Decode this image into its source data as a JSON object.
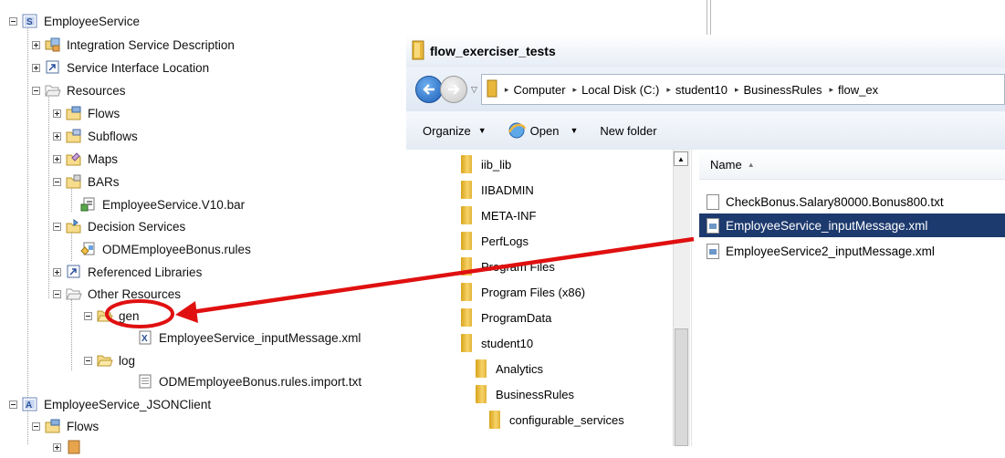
{
  "tree": {
    "items": [
      {
        "label": "EmployeeService"
      },
      {
        "label": "Integration Service Description"
      },
      {
        "label": "Service Interface Location"
      },
      {
        "label": "Resources"
      },
      {
        "label": "Flows"
      },
      {
        "label": "Subflows"
      },
      {
        "label": "Maps"
      },
      {
        "label": "BARs"
      },
      {
        "label": "EmployeeService.V10.bar"
      },
      {
        "label": "Decision Services"
      },
      {
        "label": "ODMEmployeeBonus.rules"
      },
      {
        "label": "Referenced Libraries"
      },
      {
        "label": "Other Resources"
      },
      {
        "label": "gen"
      },
      {
        "label": "EmployeeService_inputMessage.xml"
      },
      {
        "label": "log"
      },
      {
        "label": "ODMEmployeeBonus.rules.import.txt"
      },
      {
        "label": "EmployeeService_JSONClient"
      },
      {
        "label": "Flows"
      }
    ]
  },
  "explorer": {
    "title": "flow_exerciser_tests",
    "breadcrumbs": [
      "Computer",
      "Local Disk (C:)",
      "student10",
      "BusinessRules",
      "flow_ex"
    ],
    "toolbar": {
      "organize": "Organize",
      "open": "Open",
      "new_folder": "New folder"
    },
    "nav_folders": [
      "iib_lib",
      "IIBADMIN",
      "META-INF",
      "PerfLogs",
      "Program Files",
      "Program Files (x86)",
      "ProgramData",
      "student10",
      "Analytics",
      "BusinessRules",
      "configurable_services"
    ],
    "column_header": "Name",
    "files": [
      {
        "name": "CheckBonus.Salary80000.Bonus800.txt",
        "selected": false
      },
      {
        "name": "EmployeeService_inputMessage.xml",
        "selected": true
      },
      {
        "name": "EmployeeService2_inputMessage.xml",
        "selected": false
      }
    ]
  },
  "annotation": {
    "color": "#e01010"
  }
}
